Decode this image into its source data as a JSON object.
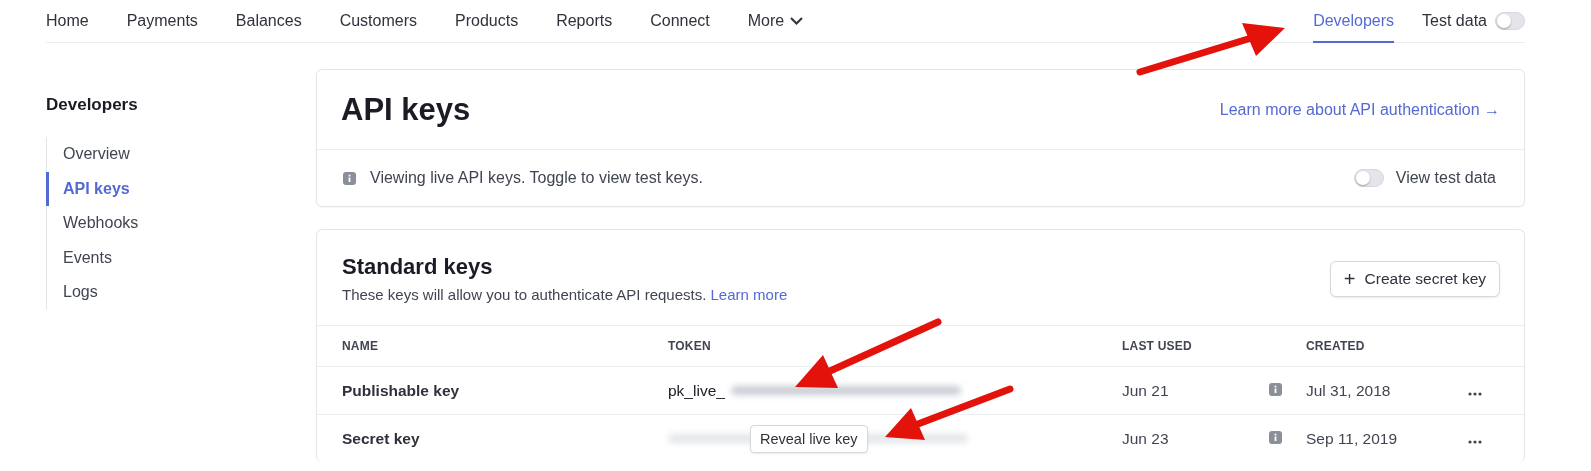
{
  "top_nav": {
    "items": [
      {
        "label": "Home",
        "selected": false,
        "dropdown": false
      },
      {
        "label": "Payments",
        "selected": false,
        "dropdown": false
      },
      {
        "label": "Balances",
        "selected": false,
        "dropdown": false
      },
      {
        "label": "Customers",
        "selected": false,
        "dropdown": false
      },
      {
        "label": "Products",
        "selected": false,
        "dropdown": false
      },
      {
        "label": "Reports",
        "selected": false,
        "dropdown": false
      },
      {
        "label": "Connect",
        "selected": false,
        "dropdown": false
      },
      {
        "label": "More",
        "selected": false,
        "dropdown": true
      }
    ],
    "right_items": [
      {
        "label": "Developers",
        "selected": true
      }
    ],
    "test_toggle": {
      "label": "Test data",
      "on": false
    }
  },
  "sidebar": {
    "title": "Developers",
    "items": [
      {
        "label": "Overview",
        "selected": false
      },
      {
        "label": "API keys",
        "selected": true
      },
      {
        "label": "Webhooks",
        "selected": false
      },
      {
        "label": "Events",
        "selected": false
      },
      {
        "label": "Logs",
        "selected": false
      }
    ]
  },
  "api_card": {
    "title": "API keys",
    "link": "Learn more about API authentication →",
    "notice": "Viewing live API keys. Toggle to view test keys.",
    "toggle": {
      "label": "View test data",
      "on": false
    }
  },
  "keys_card": {
    "title": "Standard keys",
    "description": "These keys will allow you to authenticate API requests.",
    "description_link": "Learn more",
    "button": {
      "icon": "+",
      "label": "Create secret key"
    },
    "columns": [
      "NAME",
      "TOKEN",
      "LAST USED",
      "CREATED"
    ],
    "rows": [
      {
        "name": "Publishable key",
        "token_prefix": "pk_live_",
        "last_used": "Jun 21",
        "created": "Jul 31, 2018"
      },
      {
        "name": "Secret key",
        "reveal_button": "Reveal live key",
        "last_used": "Jun 23",
        "created": "Sep 11, 2019"
      }
    ]
  }
}
